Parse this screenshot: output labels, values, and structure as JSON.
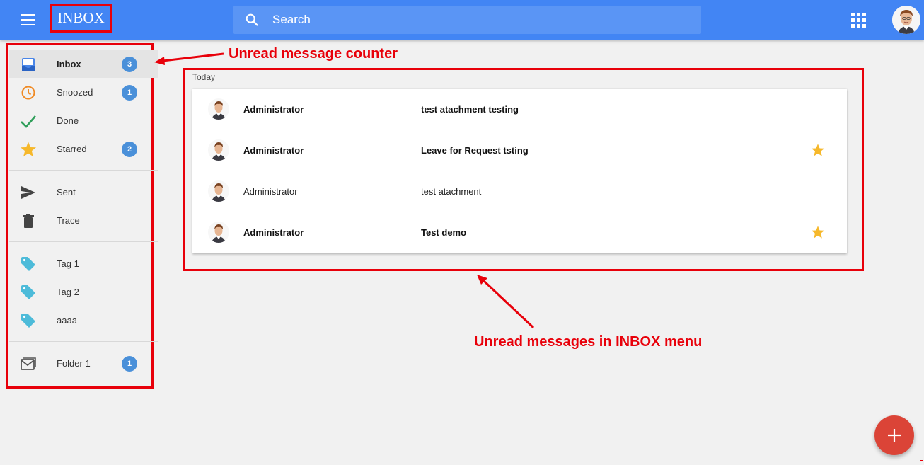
{
  "header": {
    "title": "INBOX",
    "search_placeholder": "Search"
  },
  "sidebar": {
    "groups": [
      [
        {
          "label": "Inbox",
          "icon": "inbox-icon",
          "badge": "3",
          "active": true
        },
        {
          "label": "Snoozed",
          "icon": "clock-icon",
          "badge": "1"
        },
        {
          "label": "Done",
          "icon": "check-icon",
          "badge": ""
        },
        {
          "label": "Starred",
          "icon": "star-icon",
          "badge": "2"
        }
      ],
      [
        {
          "label": "Sent",
          "icon": "send-icon",
          "badge": ""
        },
        {
          "label": "Trace",
          "icon": "trash-icon",
          "badge": ""
        }
      ],
      [
        {
          "label": "Tag 1",
          "icon": "tag-icon",
          "badge": ""
        },
        {
          "label": "Tag 2",
          "icon": "tag-icon",
          "badge": ""
        },
        {
          "label": "aaaa",
          "icon": "tag-icon",
          "badge": ""
        }
      ],
      [
        {
          "label": "Folder 1",
          "icon": "folder-mail-icon",
          "badge": "1"
        }
      ]
    ]
  },
  "annotations": {
    "counter": "Unread message counter",
    "messages": "Unread messages in INBOX menu"
  },
  "messages": {
    "section_label": "Today",
    "items": [
      {
        "sender": "Administrator",
        "subject": "test atachment testing",
        "unread": true,
        "starred": false
      },
      {
        "sender": "Administrator",
        "subject": "Leave for Request tsting",
        "unread": true,
        "starred": true
      },
      {
        "sender": "Administrator",
        "subject": "test atachment",
        "unread": false,
        "starred": false
      },
      {
        "sender": "Administrator",
        "subject": "Test demo",
        "unread": true,
        "starred": true
      }
    ]
  },
  "colors": {
    "topbar": "#4285f4",
    "annotation": "#e8000a",
    "badge": "#4a90d9",
    "fab": "#db4437",
    "star": "#f6b82b",
    "tag": "#4dbbd9"
  }
}
